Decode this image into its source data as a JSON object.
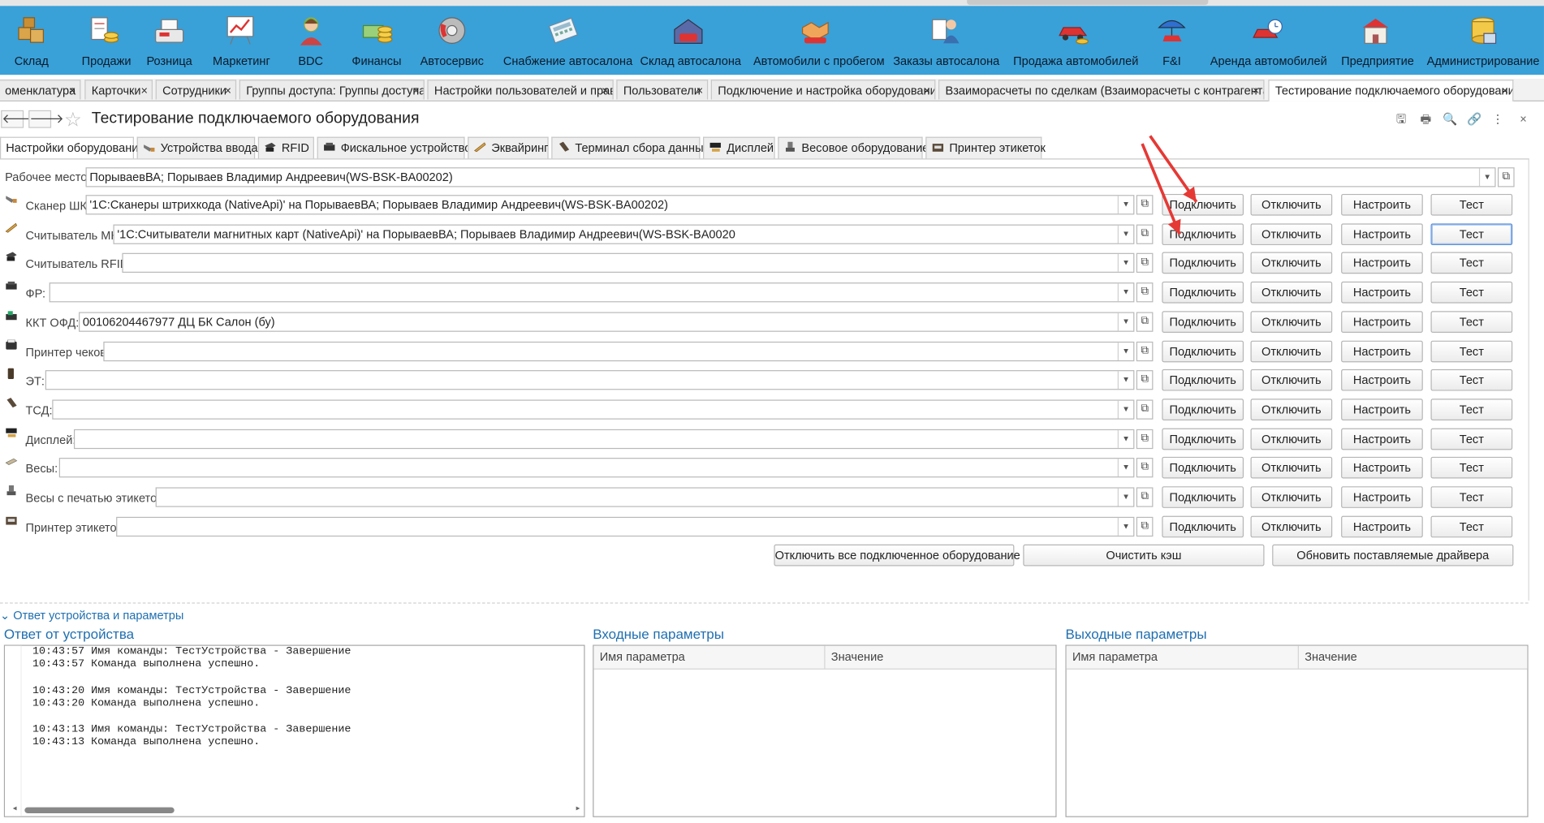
{
  "sections": [
    {
      "label": "Склад",
      "icon": "warehouse-boxes-icon"
    },
    {
      "label": "Продажи",
      "icon": "sales-coins-icon"
    },
    {
      "label": "Розница",
      "icon": "cash-register-icon"
    },
    {
      "label": "Маркетинг",
      "icon": "marketing-chart-icon"
    },
    {
      "label": "BDC",
      "icon": "operator-headset-icon"
    },
    {
      "label": "Финансы",
      "icon": "finance-money-icon"
    },
    {
      "label": "Автосервис",
      "icon": "brake-disc-icon"
    },
    {
      "label": "Снабжение автосалона",
      "icon": "calculator-icon"
    },
    {
      "label": "Склад автосалона",
      "icon": "garage-car-icon"
    },
    {
      "label": "Автомобили с пробегом",
      "icon": "handshake-icon"
    },
    {
      "label": "Заказы автосалона",
      "icon": "order-person-icon"
    },
    {
      "label": "Продажа автомобилей",
      "icon": "car-coins-icon"
    },
    {
      "label": "F&I",
      "icon": "umbrella-car-icon"
    },
    {
      "label": "Аренда автомобилей",
      "icon": "car-clock-icon"
    },
    {
      "label": "Предприятие",
      "icon": "building-icon"
    },
    {
      "label": "Администрирование",
      "icon": "database-server-icon"
    }
  ],
  "open_tabs": [
    "оменклатура",
    "Карточки",
    "Сотрудники",
    "Группы доступа: Группы доступа",
    "Настройки пользователей и прав",
    "Пользователи",
    "Подключение и настройка оборудования",
    "Взаиморасчеты по сделкам (Взаиморасчеты с контрагентами)",
    "Тестирование подключаемого оборудования"
  ],
  "close_glyph": "×",
  "page": {
    "title": "Тестирование подключаемого оборудования",
    "back": "🡐",
    "forward": "🡒"
  },
  "toolbar_icons": [
    "save-icon",
    "print-icon",
    "preview-icon",
    "link-icon",
    "more-icon",
    "close-icon"
  ],
  "toolbar_glyphs": [
    "🖫",
    "🖶",
    "🔍",
    "🔗",
    "⋮",
    "×"
  ],
  "inner_tabs": [
    "Настройки оборудования",
    "Устройства ввода",
    "RFID",
    "Фискальное устройство",
    "Эквайринг",
    "Терминал сбора данных",
    "Дисплей",
    "Весовое оборудование",
    "Принтер этикеток"
  ],
  "workplace": {
    "label": "Рабочее место:",
    "value": "ПорываевВА; Порываев Владимир Андреевич(WS-BSK-BA00202)"
  },
  "device_rows": [
    {
      "label": "Сканер ШК:",
      "value": "'1С:Сканеры штрихкода (NativeApi)' на ПорываевВА; Порываев Владимир Андреевич(WS-BSK-BA00202)",
      "icon": "barcode-scanner-icon"
    },
    {
      "label": "Считыватель МК:",
      "value": "'1С:Считыватели магнитных карт (NativeApi)' на ПорываевВА; Порываев Владимир Андреевич(WS-BSK-BA0020",
      "icon": "card-reader-icon"
    },
    {
      "label": "Считыватель RFID:",
      "value": "",
      "icon": "rfid-reader-icon"
    },
    {
      "label": "ФР:",
      "value": "",
      "icon": "fiscal-register-icon"
    },
    {
      "label": "ККТ ОФД:",
      "value": "00106204467977 ДЦ БК Салон (бу)",
      "icon": "online-register-icon"
    },
    {
      "label": "Принтер чеков:",
      "value": "",
      "icon": "receipt-printer-icon"
    },
    {
      "label": "ЭТ:",
      "value": "",
      "icon": "acquiring-terminal-icon"
    },
    {
      "label": "ТСД:",
      "value": "",
      "icon": "data-terminal-icon"
    },
    {
      "label": "Дисплей:",
      "value": "",
      "icon": "customer-display-icon"
    },
    {
      "label": "Весы:",
      "value": "",
      "icon": "scales-icon"
    },
    {
      "label": "Весы с печатью этикеток:",
      "value": "",
      "icon": "label-scales-icon"
    },
    {
      "label": "Принтер этикеток:",
      "value": "",
      "icon": "label-printer-icon"
    }
  ],
  "row_buttons": {
    "connect": "Подключить",
    "disconnect": "Отключить",
    "configure": "Настроить",
    "test": "Тест"
  },
  "bottom_buttons": {
    "disconnect_all": "Отключить все подключенное оборудование",
    "clear_cache": "Очистить кэш",
    "update_drivers": "Обновить поставляемые драйвера"
  },
  "response": {
    "toggle": "Ответ устройства и параметры",
    "device_response_title": "Ответ от устройства",
    "log": "10:43:57 Имя команды: ТестУстройства - Завершение\n10:43:57 Команда выполнена успешно.\n\n10:43:20 Имя команды: ТестУстройства - Завершение\n10:43:20 Команда выполнена успешно.\n\n10:43:13 Имя команды: ТестУстройства - Завершение\n10:43:13 Команда выполнена успешно.",
    "input_title": "Входные параметры",
    "output_title": "Выходные параметры",
    "col_name": "Имя параметра",
    "col_value": "Значение"
  },
  "colors": {
    "section_bar": "#3aa0d8",
    "accent": "#1f6fb0",
    "annotation_arrow": "#e53935"
  }
}
